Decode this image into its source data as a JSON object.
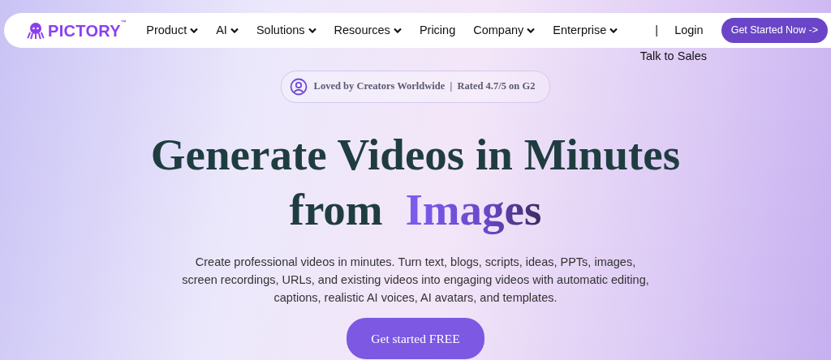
{
  "nav": {
    "logo": "PICTORY",
    "logo_mark": "™",
    "items": [
      {
        "label": "Product",
        "dropdown": true
      },
      {
        "label": "AI",
        "dropdown": true
      },
      {
        "label": "Solutions",
        "dropdown": true
      },
      {
        "label": "Resources",
        "dropdown": true
      },
      {
        "label": "Pricing",
        "dropdown": false
      },
      {
        "label": "Company",
        "dropdown": true
      },
      {
        "label": "Enterprise",
        "dropdown": true
      }
    ],
    "separator": "|",
    "login": "Login",
    "cta": "Get Started Now ->",
    "talk_to_sales": "Talk to Sales"
  },
  "hero": {
    "badge": "Loved by Creators Worldwide  |  Rated 4.7/5 on G2",
    "title": "Generate Videos in Minutes from",
    "title_highlight": "Images",
    "description": "Create professional videos in minutes. Turn text, blogs, scripts, ideas, PPTs, images, screen recordings, URLs, and existing videos into engaging videos with automatic editing, captions, realistic AI voices, AI avatars, and templates.",
    "cta": "Get started FREE"
  }
}
